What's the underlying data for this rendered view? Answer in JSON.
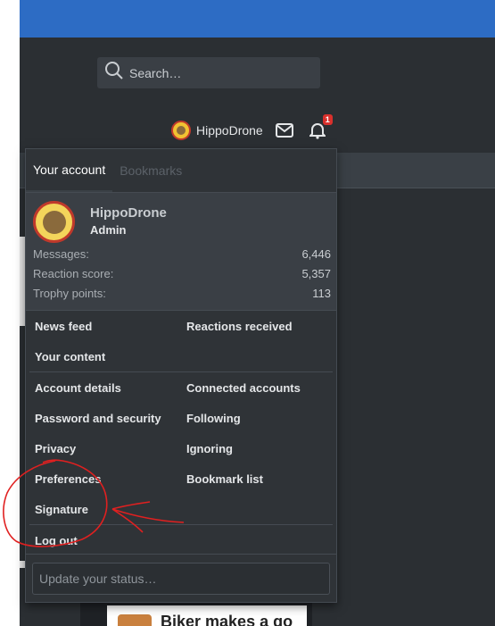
{
  "header": {
    "search_placeholder": "Search…",
    "username": "HippoDrone",
    "alerts_count": "1"
  },
  "background": {
    "tab_hint": "Bookmarks",
    "teaser_text": "Biker makes a go"
  },
  "account_menu": {
    "tabs": [
      {
        "label": "Your account",
        "active": true
      },
      {
        "label": "Bookmarks",
        "active": false
      }
    ],
    "profile": {
      "name": "HippoDrone",
      "role": "Admin",
      "stats": [
        {
          "label": "Messages:",
          "value": "6,446"
        },
        {
          "label": "Reaction score:",
          "value": "5,357"
        },
        {
          "label": "Trophy points:",
          "value": "113"
        }
      ]
    },
    "links_group1": [
      [
        "News feed",
        "Reactions received"
      ],
      [
        "Your content",
        ""
      ]
    ],
    "links_group2": [
      [
        "Account details",
        "Connected accounts"
      ],
      [
        "Password and security",
        "Following"
      ],
      [
        "Privacy",
        "Ignoring"
      ],
      [
        "Preferences",
        "Bookmark list"
      ],
      [
        "Signature",
        ""
      ]
    ],
    "logout_label": "Log out",
    "status_placeholder": "Update your status…"
  },
  "colors": {
    "topbar": "#2d6cc4",
    "page_bg": "#2b2f33",
    "menu_bg": "#2f3337",
    "annotation_red": "#e02020",
    "badge_red": "#d9302c"
  },
  "icons": [
    "search-icon",
    "envelope-icon",
    "bell-icon",
    "avatar"
  ]
}
